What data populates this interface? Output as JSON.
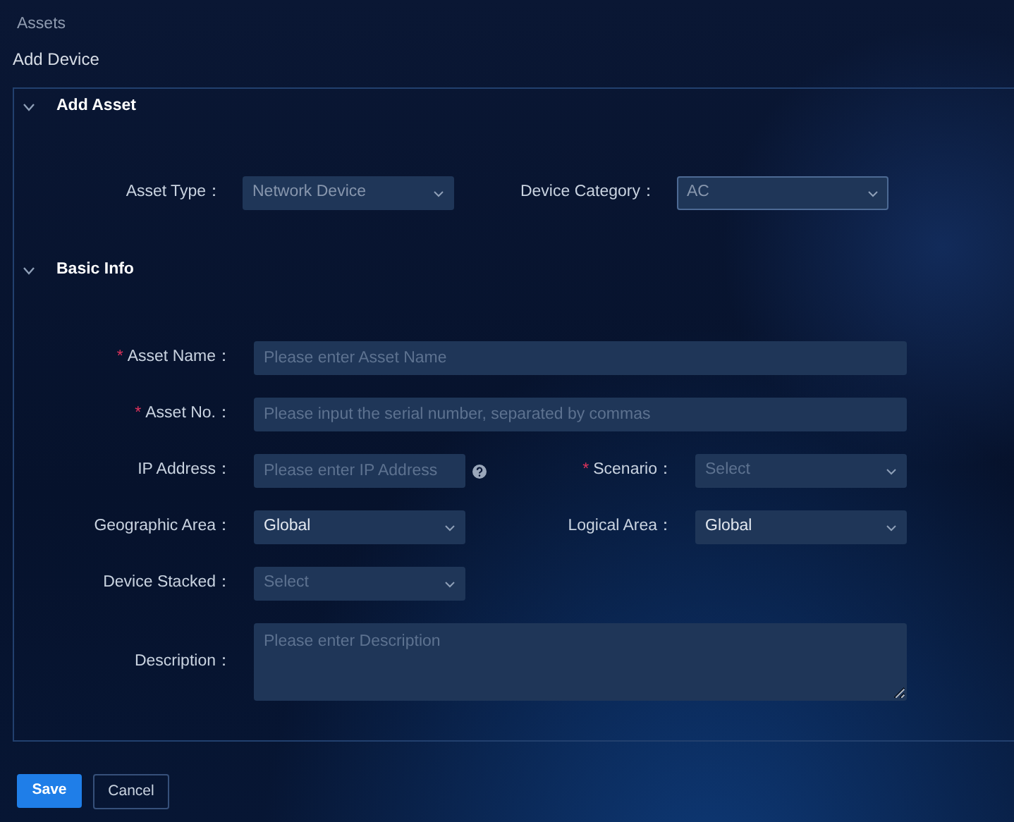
{
  "breadcrumb": "Assets",
  "page_title": "Add Device",
  "sections": [
    {
      "title": "Add Asset",
      "expanded": true,
      "kind": "inline",
      "rows": [
        [
          {
            "label": "Asset Type：",
            "kind": "select",
            "value": "Network Device",
            "focused": false,
            "disabled": true
          },
          {
            "label": "Device Category：",
            "kind": "select",
            "value": "AC",
            "focused": true,
            "disabled": true
          }
        ]
      ]
    },
    {
      "title": "Basic Info",
      "expanded": true,
      "kind": "form",
      "rows": [
        [
          {
            "mark": "*",
            "label": "Asset Name：",
            "kind": "input",
            "placeholder": "Please enter Asset Name",
            "wide": true
          }
        ],
        [
          {
            "mark": "*",
            "label": "Asset No.：",
            "kind": "input",
            "placeholder": "Please input the serial number, separated by commas",
            "wide": true
          }
        ],
        [
          {
            "label": "IP Address：",
            "kind": "input",
            "placeholder": "Please enter IP Address",
            "help": true
          },
          {
            "mark": "*",
            "label": "Scenario：",
            "kind": "select",
            "placeholder": "Select"
          }
        ],
        [
          {
            "label": "Geographic Area：",
            "kind": "select",
            "value": "Global"
          },
          {
            "label": "Logical Area：",
            "kind": "select",
            "value": "Global"
          }
        ],
        [
          {
            "label": "Device Stacked：",
            "kind": "select",
            "placeholder": "Select"
          }
        ],
        [
          {
            "label": "Description：",
            "kind": "textarea",
            "placeholder": "Please enter Description",
            "wide": true
          }
        ]
      ]
    }
  ],
  "buttons": [
    {
      "label": "Save",
      "kind": "primary"
    },
    {
      "label": "Cancel",
      "kind": "outline"
    }
  ]
}
